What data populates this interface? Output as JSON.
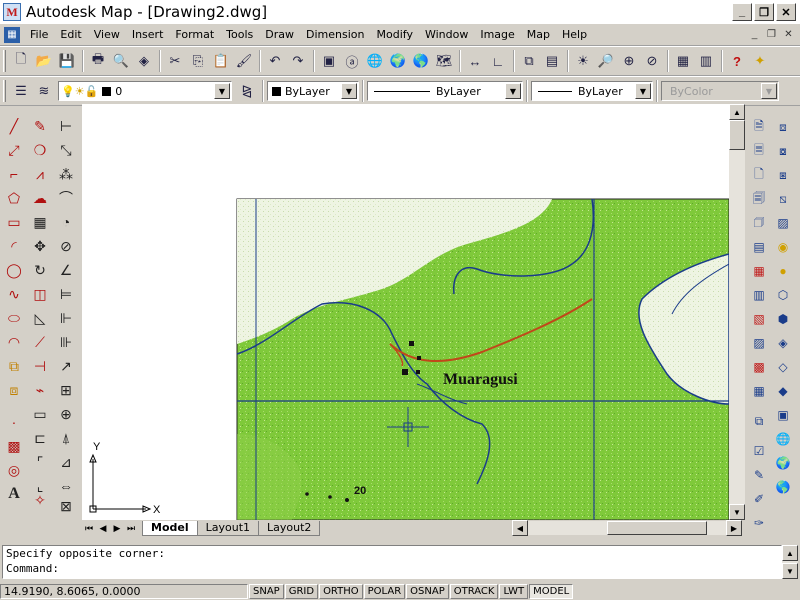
{
  "window": {
    "title": "Autodesk Map - [Drawing2.dwg]",
    "app_icon": "autodesk-map-icon"
  },
  "menubar": {
    "items": [
      "File",
      "Edit",
      "View",
      "Insert",
      "Format",
      "Tools",
      "Draw",
      "Dimension",
      "Modify",
      "Window",
      "Image",
      "Map",
      "Help"
    ]
  },
  "properties": {
    "layer": "0",
    "color": "ByLayer",
    "linetype": "ByLayer",
    "lineweight": "ByLayer",
    "plotstyle": "ByColor"
  },
  "map": {
    "place_label": "Muaragusi",
    "contour_label": "20",
    "colors": {
      "vegetation": "#7fc93a",
      "water": "#1a3c8a",
      "road": "#c0481a",
      "clear": "#f2f6ea"
    }
  },
  "ucs": {
    "x_label": "X",
    "y_label": "Y"
  },
  "tabs": {
    "model": "Model",
    "layout1": "Layout1",
    "layout2": "Layout2"
  },
  "command": {
    "line1": "Specify opposite corner:",
    "line2": "Command:"
  },
  "status": {
    "coords": "14.9190, 8.6065, 0.0000",
    "buttons": [
      "SNAP",
      "GRID",
      "ORTHO",
      "POLAR",
      "OSNAP",
      "OTRACK",
      "LWT",
      "MODEL"
    ]
  }
}
